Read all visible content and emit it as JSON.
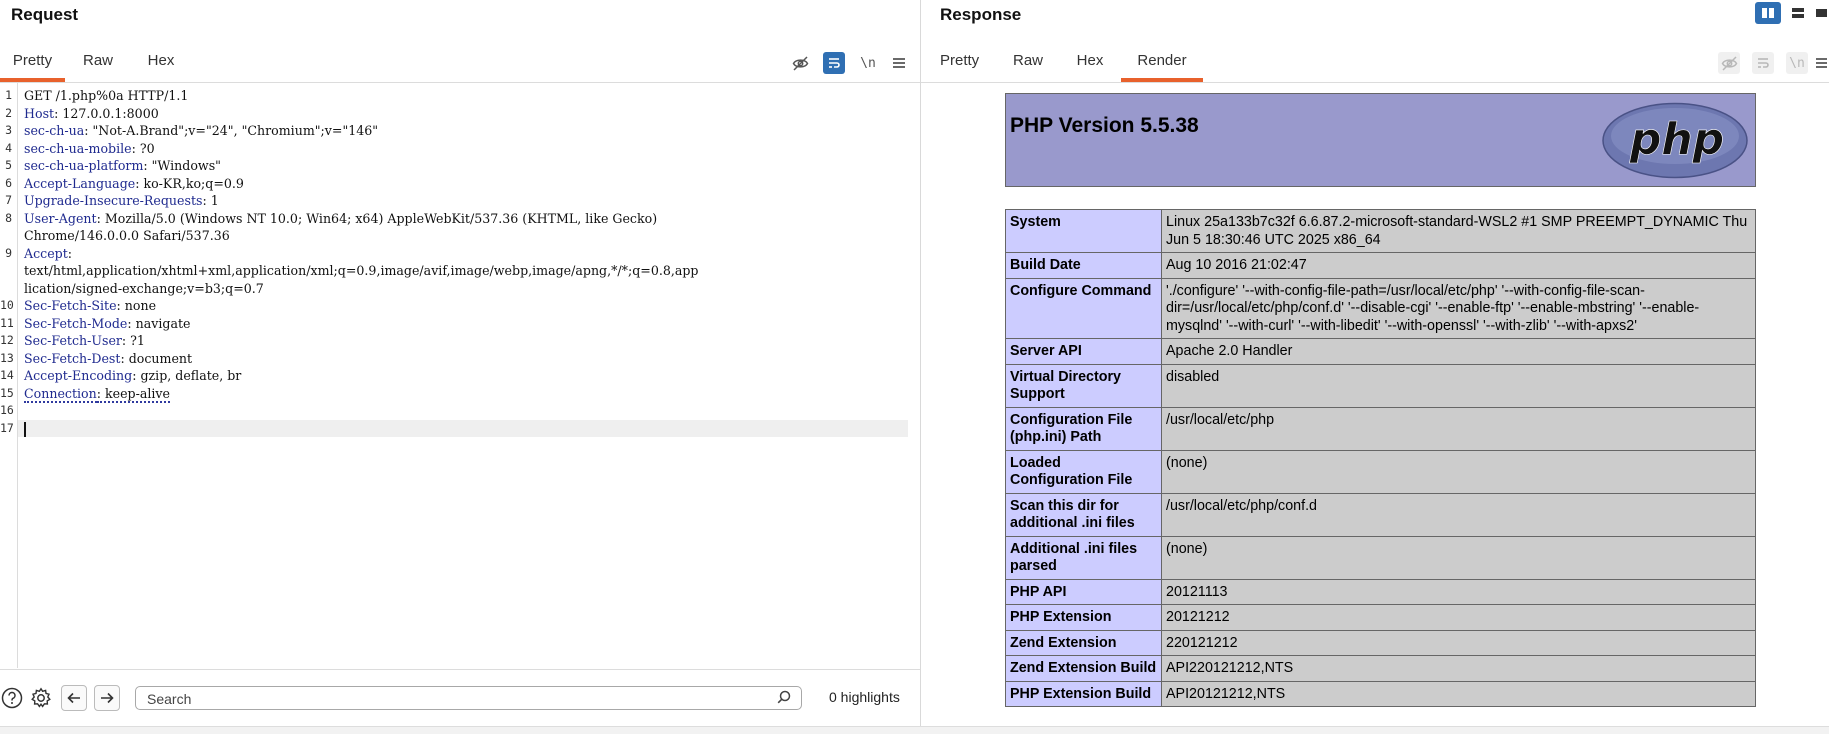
{
  "request": {
    "title": "Request",
    "tabs": [
      {
        "label": "Pretty",
        "active": true
      },
      {
        "label": "Raw",
        "active": false
      },
      {
        "label": "Hex",
        "active": false
      }
    ],
    "toolbar": {
      "newline_label": "\\n",
      "menu_icon": "hamburger-icon",
      "hide_icon": "eye-slash-icon",
      "wrap_icon": "word-wrap-icon"
    },
    "lines": [
      {
        "n": "1",
        "key": "",
        "val": "GET /1.php%0a HTTP/1.1"
      },
      {
        "n": "2",
        "key": "Host",
        "val": ": 127.0.0.1:8000"
      },
      {
        "n": "3",
        "key": "sec-ch-ua",
        "val": ": \"Not-A.Brand\";v=\"24\", \"Chromium\";v=\"146\""
      },
      {
        "n": "4",
        "key": "sec-ch-ua-mobile",
        "val": ": ?0"
      },
      {
        "n": "5",
        "key": "sec-ch-ua-platform",
        "val": ": \"Windows\""
      },
      {
        "n": "6",
        "key": "Accept-Language",
        "val": ": ko-KR,ko;q=0.9"
      },
      {
        "n": "7",
        "key": "Upgrade-Insecure-Requests",
        "val": ": 1"
      },
      {
        "n": "8",
        "key": "User-Agent",
        "val": ": Mozilla/5.0 (Windows NT 10.0; Win64; x64) AppleWebKit/537.36 (KHTML, like Gecko)"
      },
      {
        "n": "",
        "key": "",
        "val": "Chrome/146.0.0.0 Safari/537.36"
      },
      {
        "n": "9",
        "key": "Accept",
        "val": ":"
      },
      {
        "n": "",
        "key": "",
        "val": "text/html,application/xhtml+xml,application/xml;q=0.9,image/avif,image/webp,image/apng,*/*;q=0.8,app"
      },
      {
        "n": "",
        "key": "",
        "val": "lication/signed-exchange;v=b3;q=0.7"
      },
      {
        "n": "10",
        "key": "Sec-Fetch-Site",
        "val": ": none"
      },
      {
        "n": "11",
        "key": "Sec-Fetch-Mode",
        "val": ": navigate"
      },
      {
        "n": "12",
        "key": "Sec-Fetch-User",
        "val": ": ?1"
      },
      {
        "n": "13",
        "key": "Sec-Fetch-Dest",
        "val": ": document"
      },
      {
        "n": "14",
        "key": "Accept-Encoding",
        "val": ": gzip, deflate, br"
      },
      {
        "n": "15",
        "key": "Connection",
        "val": ": keep-alive"
      },
      {
        "n": "16",
        "key": "",
        "val": ""
      },
      {
        "n": "17",
        "key": "",
        "val": ""
      }
    ],
    "search": {
      "placeholder": "Search",
      "value": ""
    },
    "highlights": "0 highlights"
  },
  "response": {
    "title": "Response",
    "tabs": [
      {
        "label": "Pretty",
        "active": false
      },
      {
        "label": "Raw",
        "active": false
      },
      {
        "label": "Hex",
        "active": false
      },
      {
        "label": "Render",
        "active": true
      }
    ],
    "php_title": "PHP Version 5.5.38",
    "php_logo_text": "php",
    "rows": [
      {
        "k": "System",
        "v": "Linux 25a133b7c32f 6.6.87.2-microsoft-standard-WSL2 #1 SMP PREEMPT_DYNAMIC Thu Jun 5 18:30:46 UTC 2025 x86_64"
      },
      {
        "k": "Build Date",
        "v": "Aug 10 2016 21:02:47"
      },
      {
        "k": "Configure Command",
        "v": "'./configure' '--with-config-file-path=/usr/local/etc/php' '--with-config-file-scan-dir=/usr/local/etc/php/conf.d' '--disable-cgi' '--enable-ftp' '--enable-mbstring' '--enable-mysqlnd' '--with-curl' '--with-libedit' '--with-openssl' '--with-zlib' '--with-apxs2'"
      },
      {
        "k": "Server API",
        "v": "Apache 2.0 Handler"
      },
      {
        "k": "Virtual Directory Support",
        "v": "disabled"
      },
      {
        "k": "Configuration File (php.ini) Path",
        "v": "/usr/local/etc/php"
      },
      {
        "k": "Loaded Configuration File",
        "v": "(none)"
      },
      {
        "k": "Scan this dir for additional .ini files",
        "v": "/usr/local/etc/php/conf.d"
      },
      {
        "k": "Additional .ini files parsed",
        "v": "(none)"
      },
      {
        "k": "PHP API",
        "v": "20121113"
      },
      {
        "k": "PHP Extension",
        "v": "20121212"
      },
      {
        "k": "Zend Extension",
        "v": "220121212"
      },
      {
        "k": "Zend Extension Build",
        "v": "API220121212,NTS"
      },
      {
        "k": "PHP Extension Build",
        "v": "API20121212,NTS"
      }
    ]
  },
  "colors": {
    "accent": "#e8612c",
    "toggle_on": "#2f6fb3",
    "php_header": "#9999cc",
    "php_key": "#ccccff",
    "php_value": "#cccccc"
  }
}
